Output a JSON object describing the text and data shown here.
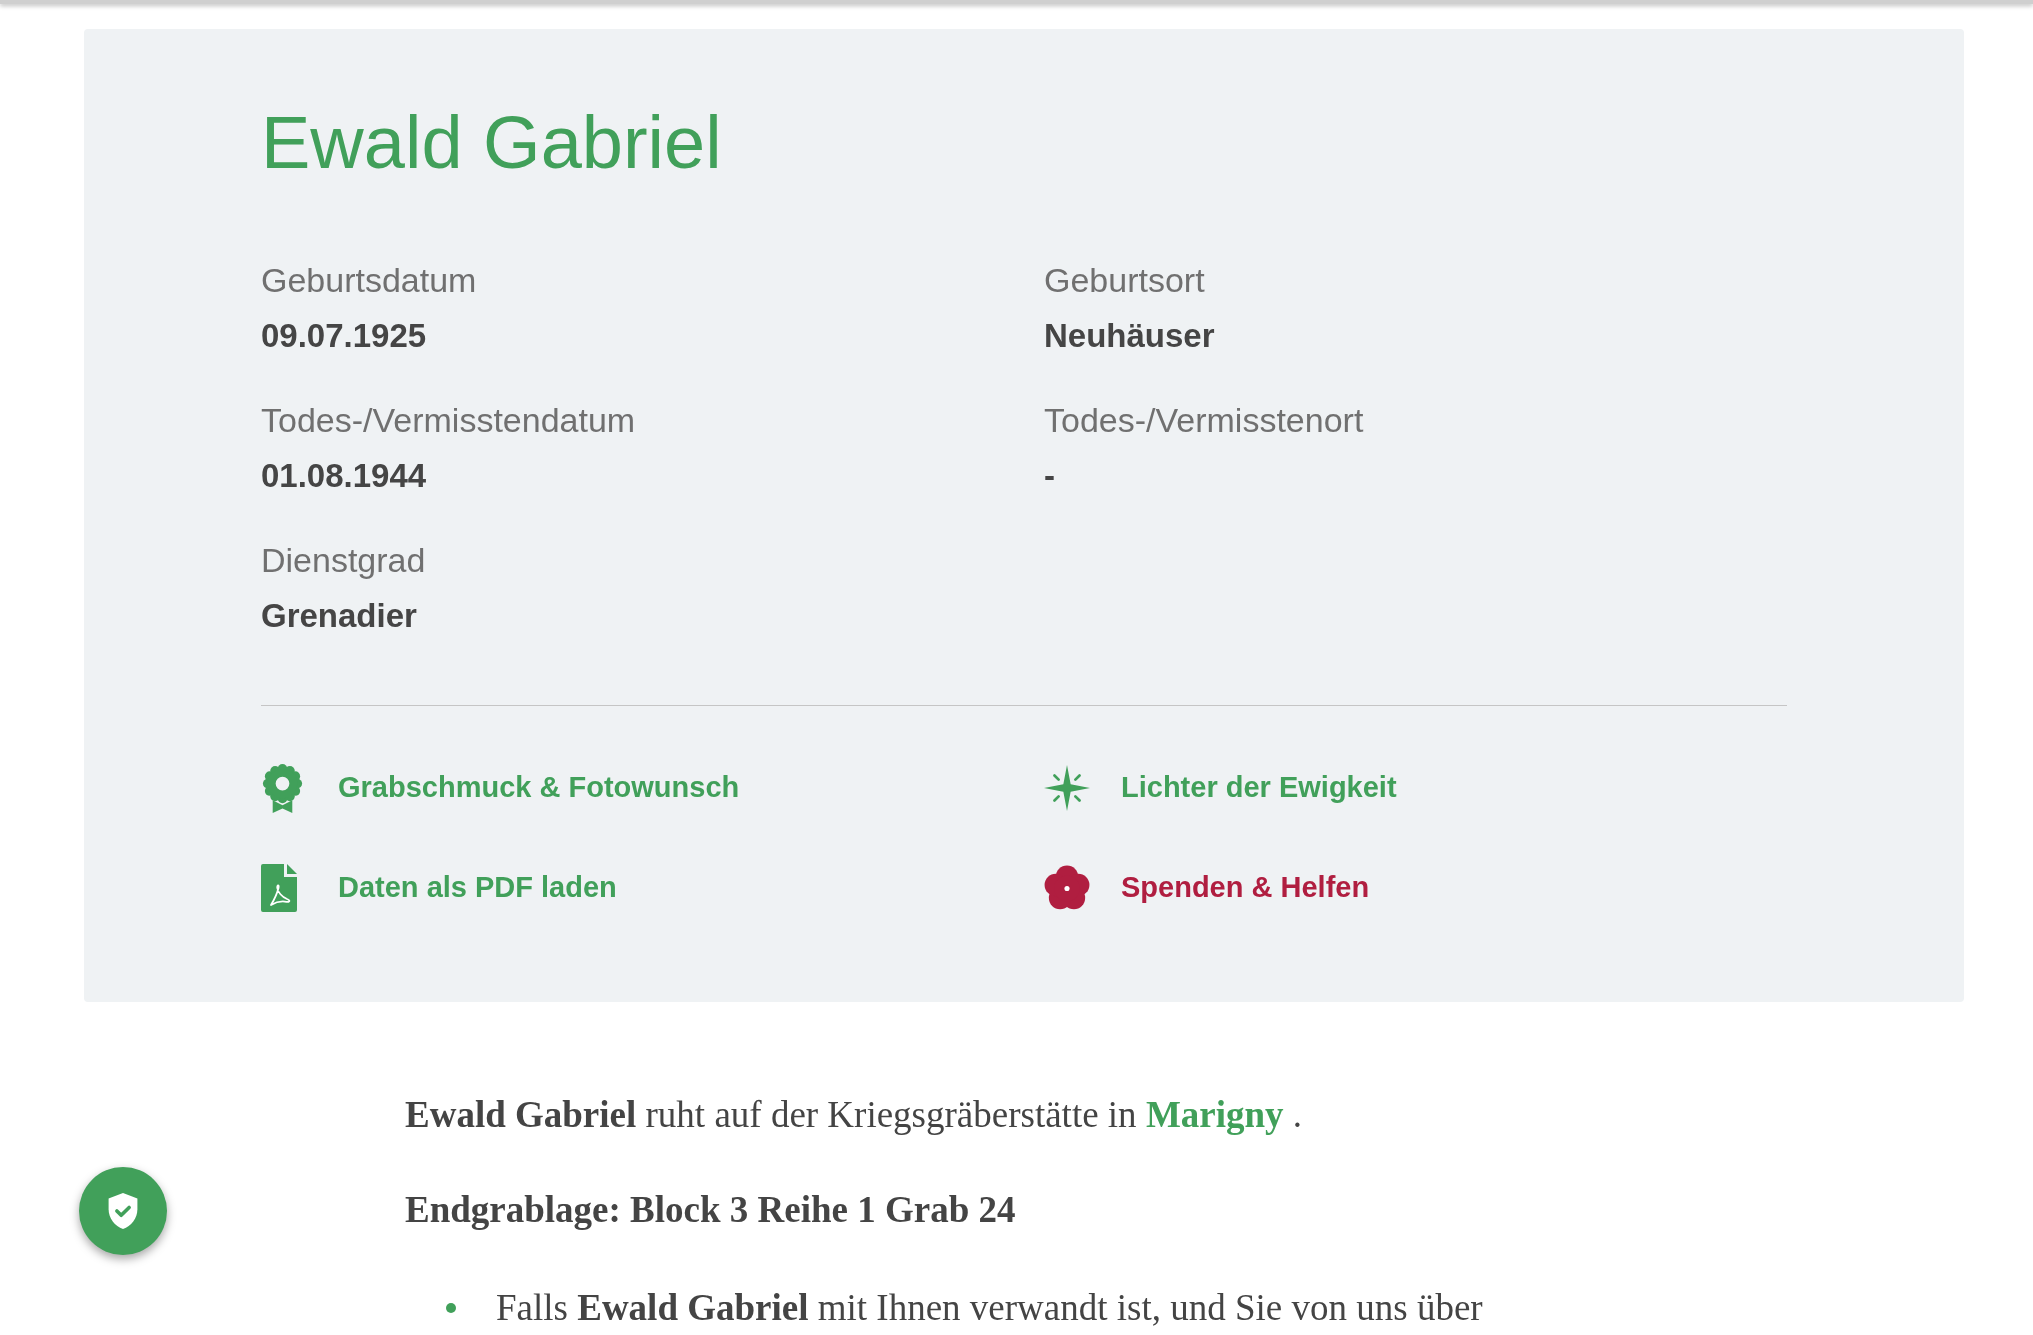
{
  "person": {
    "name": "Ewald Gabriel",
    "details": [
      {
        "label": "Geburtsdatum",
        "value": "09.07.1925"
      },
      {
        "label": "Geburtsort",
        "value": "Neuhäuser"
      },
      {
        "label": "Todes-/Vermisstendatum",
        "value": "01.08.1944"
      },
      {
        "label": "Todes-/Vermisstenort",
        "value": "-"
      },
      {
        "label": "Dienstgrad",
        "value": "Grenadier"
      }
    ],
    "actions": [
      {
        "kind": "wreath",
        "label": "Grabschmuck & Fotowunsch",
        "color": "#41a05a"
      },
      {
        "kind": "sparkle",
        "label": "Lichter der Ewigkeit",
        "color": "#41a05a"
      },
      {
        "kind": "pdf",
        "label": "Daten als PDF laden",
        "color": "#41a05a"
      },
      {
        "kind": "flower",
        "label": "Spenden & Helfen",
        "color": "#b01e40"
      }
    ]
  },
  "burial": {
    "text": "**Ewald Gabriel** ruht auf der Kriegsgräberstätte in",
    "cemetery_link": "Marigny",
    "text_end": ".",
    "grave_location": "Endgrablage: Block 3 Reihe 1 Grab 24"
  },
  "notes": [
    "Falls **Ewald Gabriel** mit Ihnen verwandt ist, und Sie von uns über"
  ]
}
